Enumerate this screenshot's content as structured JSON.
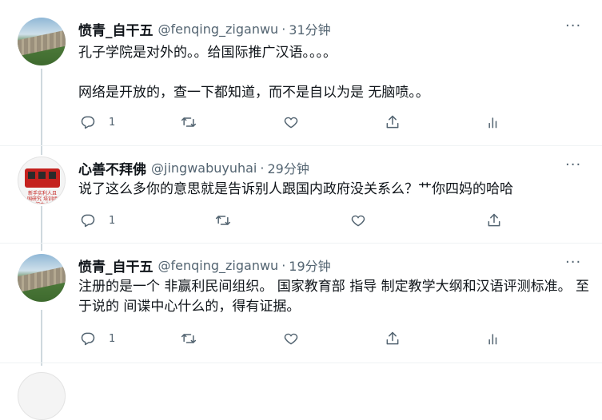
{
  "tweets": [
    {
      "name": "愤青_自干五",
      "handle": "@fenqing_ziganwu",
      "separator": "·",
      "time": "31分钟",
      "text": "孔子学院是对外的。。给国际推广汉语。。。。\n\n网络是开放的，查一下都知道，而不是自以为是 无脑喷。。",
      "reply_count": "1",
      "avatar_icon": "great-wall-photo"
    },
    {
      "name": "心善不拜佛",
      "handle": "@jingwabuyuhai",
      "separator": "·",
      "time": "29分钟",
      "text": "说了这么多你的意思就是告诉别人跟国内政府没关系么？艹你四妈的哈哈",
      "reply_count": "1",
      "avatar_icon": "red-bus-photo",
      "avatar_caption": "新手实利人且国研究 培训组织大大"
    },
    {
      "name": "愤青_自干五",
      "handle": "@fenqing_ziganwu",
      "separator": "·",
      "time": "19分钟",
      "text": "注册的是一个 非赢利民间组织。 国家教育部 指导 制定教学大纲和汉语评测标准。 至于说的 间谍中心什么的，得有证据。",
      "reply_count": "1",
      "avatar_icon": "great-wall-photo"
    }
  ],
  "more_label": "···",
  "colors": {
    "text": "#0f1419",
    "secondary": "#536471",
    "border": "#eff3f4",
    "thread": "#cfd9de"
  }
}
